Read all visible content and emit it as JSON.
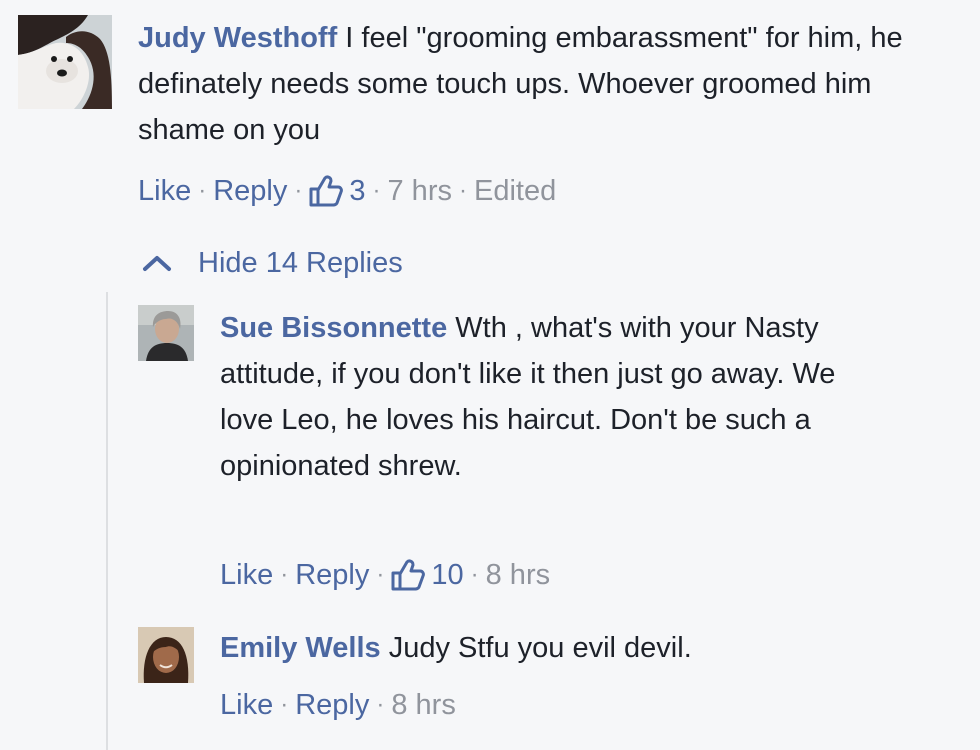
{
  "comment": {
    "author": "Judy Westhoff",
    "text": " I feel \"grooming embarassment\" for him, he definately needs some touch ups. Whoever groomed him shame on you",
    "actions": {
      "like": "Like",
      "reply": "Reply",
      "likes_count": "3",
      "time": "7 hrs",
      "edited": "Edited",
      "separator": "·"
    }
  },
  "hide_replies_label": "Hide 14 Replies",
  "replies": [
    {
      "author": "Sue Bissonnette",
      "text": " Wth , what's with your Nasty attitude, if you don't like it then just go away. We love Leo, he loves his haircut. Don't be such a opinionated shrew.",
      "actions": {
        "like": "Like",
        "reply": "Reply",
        "likes_count": "10",
        "time": "8 hrs",
        "separator": "·"
      }
    },
    {
      "author": "Emily Wells",
      "text": " Judy Stfu you evil devil.",
      "actions": {
        "like": "Like",
        "reply": "Reply",
        "time": "8 hrs",
        "separator": "·"
      }
    }
  ],
  "colors": {
    "background": "#f6f7f9",
    "link": "#4b67a1",
    "text": "#1d2129",
    "meta": "#90949c",
    "rail": "#dddfe2"
  }
}
